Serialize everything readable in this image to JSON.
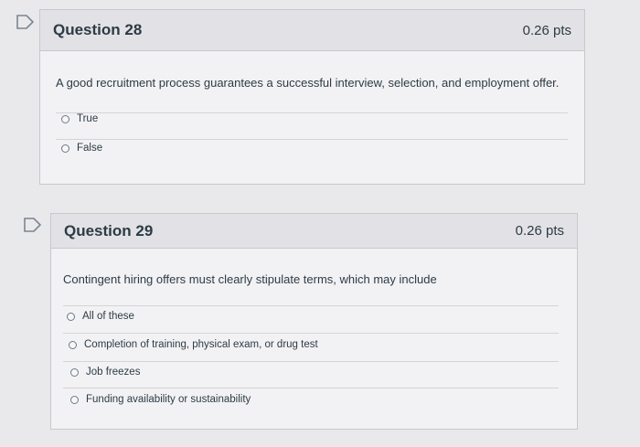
{
  "questions": [
    {
      "title": "Question 28",
      "points": "0.26 pts",
      "text": "A good recruitment process guarantees a successful interview, selection, and employment offer.",
      "answers": [
        "True",
        "False"
      ]
    },
    {
      "title": "Question 29",
      "points": "0.26 pts",
      "text": "Contingent hiring offers must clearly stipulate terms, which may include",
      "answers": [
        "All of these",
        "Completion of training, physical exam, or drug test",
        "Job freezes",
        "Funding availability or sustainability"
      ]
    }
  ],
  "icons": {
    "flag": "flag-bookmark-icon"
  },
  "colors": {
    "flag_stroke": "#6d7a85",
    "header_bg": "#e2e2e6",
    "card_bg": "#f2f2f4"
  }
}
